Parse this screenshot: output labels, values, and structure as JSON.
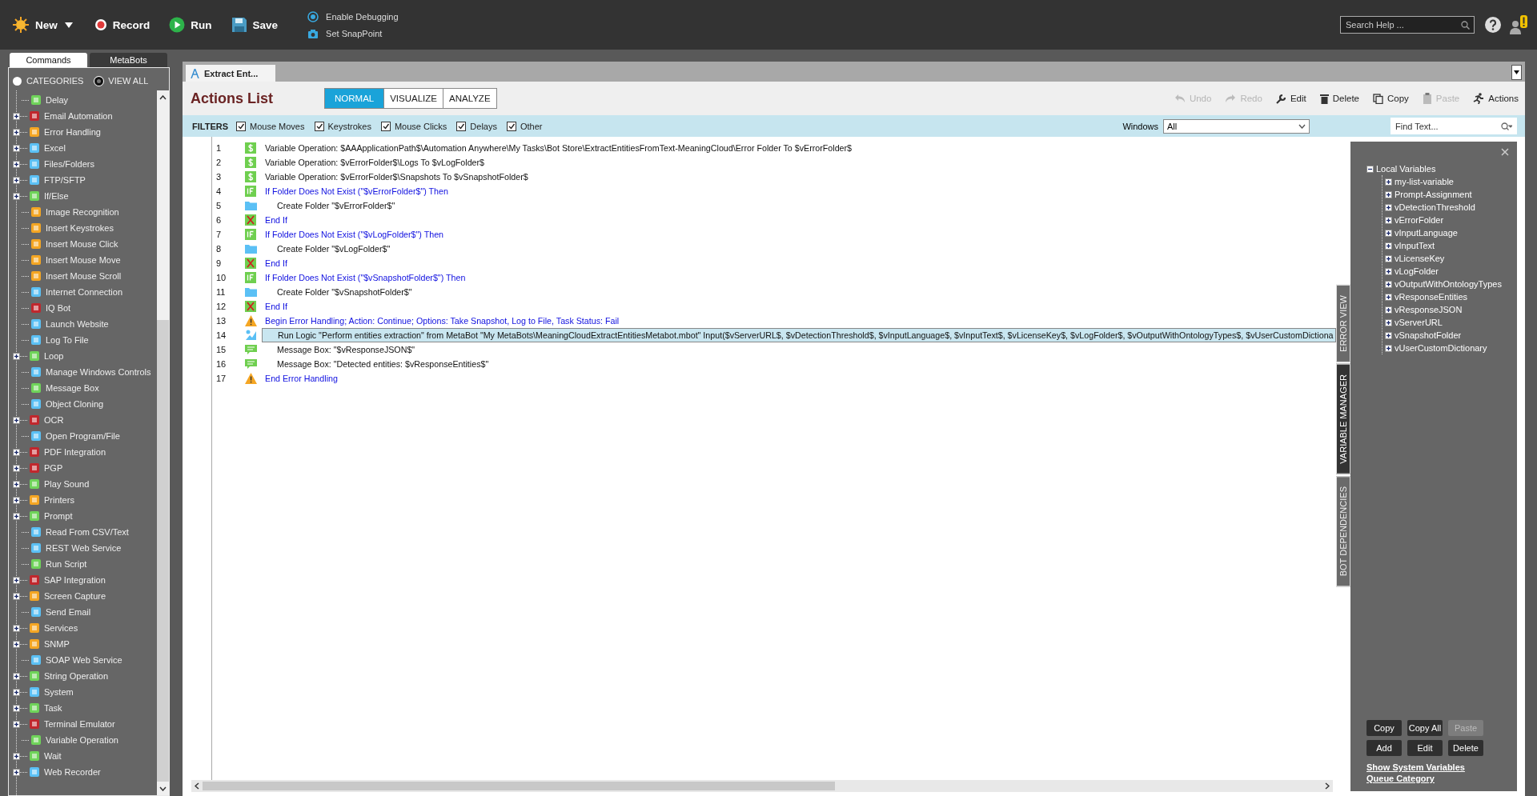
{
  "toolbar": {
    "buttons": [
      {
        "label": "New",
        "kind": "new"
      },
      {
        "label": "Record",
        "kind": "record"
      },
      {
        "label": "Run",
        "kind": "run"
      },
      {
        "label": "Save",
        "kind": "save"
      }
    ],
    "debug_options": [
      {
        "label": "Enable Debugging",
        "kind": "debug"
      },
      {
        "label": "Set SnapPoint",
        "kind": "snappoint"
      }
    ],
    "search": {
      "placeholder": "Search Help ..."
    }
  },
  "sidebar": {
    "tabs": [
      {
        "label": "Commands",
        "selected": true
      },
      {
        "label": "MetaBots",
        "selected": false
      }
    ],
    "view_options": [
      {
        "label": "CATEGORIES",
        "selected": false
      },
      {
        "label": "VIEW ALL",
        "selected": true
      }
    ],
    "commands": [
      {
        "label": "Delay",
        "expandable": false,
        "color": "#6fd35a"
      },
      {
        "label": "Email Automation",
        "expandable": true,
        "color": "#c0272d"
      },
      {
        "label": "Error Handling",
        "expandable": true,
        "color": "#f5a623"
      },
      {
        "label": "Excel",
        "expandable": true,
        "color": "#5bc0f5"
      },
      {
        "label": "Files/Folders",
        "expandable": true,
        "color": "#5bc0f5"
      },
      {
        "label": "FTP/SFTP",
        "expandable": true,
        "color": "#5bc0f5"
      },
      {
        "label": "If/Else",
        "expandable": true,
        "color": "#6fd35a"
      },
      {
        "label": "Image Recognition",
        "expandable": false,
        "color": "#f5a623"
      },
      {
        "label": "Insert Keystrokes",
        "expandable": false,
        "color": "#f5a623"
      },
      {
        "label": "Insert Mouse Click",
        "expandable": false,
        "color": "#f5a623"
      },
      {
        "label": "Insert Mouse Move",
        "expandable": false,
        "color": "#f5a623"
      },
      {
        "label": "Insert Mouse Scroll",
        "expandable": false,
        "color": "#f5a623"
      },
      {
        "label": "Internet Connection",
        "expandable": false,
        "color": "#5bc0f5"
      },
      {
        "label": "IQ Bot",
        "expandable": false,
        "color": "#c0272d"
      },
      {
        "label": "Launch Website",
        "expandable": false,
        "color": "#5bc0f5"
      },
      {
        "label": "Log To File",
        "expandable": false,
        "color": "#5bc0f5"
      },
      {
        "label": "Loop",
        "expandable": true,
        "color": "#6fd35a"
      },
      {
        "label": "Manage Windows Controls",
        "expandable": false,
        "color": "#5bc0f5"
      },
      {
        "label": "Message Box",
        "expandable": false,
        "color": "#6fd35a"
      },
      {
        "label": "Object Cloning",
        "expandable": false,
        "color": "#5bc0f5"
      },
      {
        "label": "OCR",
        "expandable": true,
        "color": "#c0272d"
      },
      {
        "label": "Open Program/File",
        "expandable": false,
        "color": "#5bc0f5"
      },
      {
        "label": "PDF Integration",
        "expandable": true,
        "color": "#c0272d"
      },
      {
        "label": "PGP",
        "expandable": true,
        "color": "#c0272d"
      },
      {
        "label": "Play Sound",
        "expandable": true,
        "color": "#6fd35a"
      },
      {
        "label": "Printers",
        "expandable": true,
        "color": "#f5a623"
      },
      {
        "label": "Prompt",
        "expandable": true,
        "color": "#6fd35a"
      },
      {
        "label": "Read From CSV/Text",
        "expandable": false,
        "color": "#5bc0f5"
      },
      {
        "label": "REST Web Service",
        "expandable": false,
        "color": "#5bc0f5"
      },
      {
        "label": "Run Script",
        "expandable": false,
        "color": "#6fd35a"
      },
      {
        "label": "SAP Integration",
        "expandable": true,
        "color": "#c0272d"
      },
      {
        "label": "Screen Capture",
        "expandable": true,
        "color": "#f5a623"
      },
      {
        "label": "Send Email",
        "expandable": false,
        "color": "#5bc0f5"
      },
      {
        "label": "Services",
        "expandable": true,
        "color": "#f5a623"
      },
      {
        "label": "SNMP",
        "expandable": true,
        "color": "#f5a623"
      },
      {
        "label": "SOAP Web Service",
        "expandable": false,
        "color": "#5bc0f5"
      },
      {
        "label": "String Operation",
        "expandable": true,
        "color": "#6fd35a"
      },
      {
        "label": "System",
        "expandable": true,
        "color": "#5bc0f5"
      },
      {
        "label": "Task",
        "expandable": true,
        "color": "#6fd35a"
      },
      {
        "label": "Terminal Emulator",
        "expandable": true,
        "color": "#c0272d"
      },
      {
        "label": "Variable Operation",
        "expandable": false,
        "color": "#6fd35a"
      },
      {
        "label": "Wait",
        "expandable": true,
        "color": "#6fd35a"
      },
      {
        "label": "Web Recorder",
        "expandable": true,
        "color": "#5bc0f5"
      }
    ]
  },
  "editor": {
    "tab_title": "Extract Ent...",
    "heading": "Actions List",
    "view_modes": [
      {
        "label": "NORMAL",
        "selected": true
      },
      {
        "label": "VISUALIZE",
        "selected": false
      },
      {
        "label": "ANALYZE",
        "selected": false
      }
    ],
    "actions": [
      {
        "label": "Undo",
        "kind": "undo",
        "disabled": true
      },
      {
        "label": "Redo",
        "kind": "redo",
        "disabled": true
      },
      {
        "label": "Edit",
        "kind": "edit",
        "disabled": false
      },
      {
        "label": "Delete",
        "kind": "delete",
        "disabled": false
      },
      {
        "label": "Copy",
        "kind": "copy",
        "disabled": false
      },
      {
        "label": "Paste",
        "kind": "paste",
        "disabled": true
      },
      {
        "label": "Actions",
        "kind": "actions",
        "disabled": false
      }
    ],
    "filters_label": "FILTERS",
    "filters": [
      {
        "label": "Mouse Moves",
        "checked": true
      },
      {
        "label": "Keystrokes",
        "checked": true
      },
      {
        "label": "Mouse Clicks",
        "checked": true
      },
      {
        "label": "Delays",
        "checked": true
      },
      {
        "label": "Other",
        "checked": true
      }
    ],
    "windows_label": "Windows",
    "windows_value": "All",
    "find": {
      "placeholder": "Find Text..."
    },
    "lines": [
      {
        "number": "1",
        "kind": "variable",
        "selected": false,
        "text": "Variable Operation: $AAApplicationPath$\\Automation Anywhere\\My Tasks\\Bot Store\\ExtractEntitiesFromText-MeaningCloud\\Error Folder To $vErrorFolder$"
      },
      {
        "number": "2",
        "kind": "variable",
        "selected": false,
        "text": "Variable Operation: $vErrorFolder$\\Logs To $vLogFolder$"
      },
      {
        "number": "3",
        "kind": "variable",
        "selected": false,
        "text": "Variable Operation: $vErrorFolder$\\Snapshots To $vSnapshotFolder$"
      },
      {
        "number": "4",
        "kind": "if",
        "selected": false,
        "text": "If Folder Does Not Exist (\"$vErrorFolder$\")  Then",
        "children": [
          {
            "number": "5",
            "kind": "folder",
            "selected": false,
            "text": "Create Folder \"$vErrorFolder$\""
          }
        ]
      },
      {
        "number": "6",
        "kind": "endif",
        "selected": false,
        "text": "End If"
      },
      {
        "number": "7",
        "kind": "if",
        "selected": false,
        "text": "If Folder Does Not Exist (\"$vLogFolder$\")  Then",
        "children": [
          {
            "number": "8",
            "kind": "folder",
            "selected": false,
            "text": "Create Folder \"$vLogFolder$\""
          }
        ]
      },
      {
        "number": "9",
        "kind": "endif",
        "selected": false,
        "text": "End If"
      },
      {
        "number": "10",
        "kind": "if",
        "selected": false,
        "text": "If Folder Does Not Exist (\"$vSnapshotFolder$\")  Then",
        "children": [
          {
            "number": "11",
            "kind": "folder",
            "selected": false,
            "text": "Create Folder \"$vSnapshotFolder$\""
          }
        ]
      },
      {
        "number": "12",
        "kind": "endif",
        "selected": false,
        "text": "End If"
      },
      {
        "number": "13",
        "kind": "error",
        "selected": false,
        "text": "Begin Error Handling; Action: Continue; Options: Take Snapshot, Log to File,  Task Status: Fail",
        "children": [
          {
            "number": "14",
            "kind": "metabot",
            "selected": true,
            "text": "Run Logic \"Perform entities extraction\" from MetaBot \"My MetaBots\\MeaningCloudExtractEntitiesMetabot.mbot\" Input($vServerURL$, $vDetectionThreshold$, $vInputLanguage$, $vInputText$, $vLicenseKey$, $vLogFolder$, $vOutputWithOntologyTypes$, $vUserCustomDictiona"
          },
          {
            "number": "15",
            "kind": "message",
            "selected": false,
            "text": "Message Box: \"$vResponseJSON$\""
          },
          {
            "number": "16",
            "kind": "message",
            "selected": false,
            "text": "Message Box: \"Detected entities: $vResponseEntities$\""
          }
        ]
      },
      {
        "number": "17",
        "kind": "error_end",
        "selected": false,
        "text": "End Error Handling"
      }
    ]
  },
  "side_tabs": [
    {
      "label": "ERROR VIEW",
      "selected": false
    },
    {
      "label": "VARIABLE MANAGER",
      "selected": true
    },
    {
      "label": "BOT DEPENDENCIES",
      "selected": false
    }
  ],
  "variables": {
    "tree": {
      "label": "Local Variables",
      "expanded": true,
      "children": [
        {
          "label": "my-list-variable",
          "expanded": false
        },
        {
          "label": "Prompt-Assignment",
          "expanded": false
        },
        {
          "label": "vDetectionThreshold",
          "expanded": false
        },
        {
          "label": "vErrorFolder",
          "expanded": false
        },
        {
          "label": "vInputLanguage",
          "expanded": false
        },
        {
          "label": "vInputText",
          "expanded": false
        },
        {
          "label": "vLicenseKey",
          "expanded": false
        },
        {
          "label": "vLogFolder",
          "expanded": false
        },
        {
          "label": "vOutputWithOntologyTypes",
          "expanded": false
        },
        {
          "label": "vResponseEntities",
          "expanded": false
        },
        {
          "label": "vResponseJSON",
          "expanded": false
        },
        {
          "label": "vServerURL",
          "expanded": false
        },
        {
          "label": "vSnapshotFolder",
          "expanded": false
        },
        {
          "label": "vUserCustomDictionary",
          "expanded": false
        }
      ]
    },
    "buttons": [
      {
        "label": "Copy",
        "disabled": false
      },
      {
        "label": "Copy All",
        "disabled": false
      },
      {
        "label": "Paste",
        "disabled": true
      },
      {
        "label": "Add",
        "disabled": false
      },
      {
        "label": "Edit",
        "disabled": false
      },
      {
        "label": "Delete",
        "disabled": false
      }
    ],
    "links": [
      "Show System Variables",
      "Queue Category"
    ]
  }
}
